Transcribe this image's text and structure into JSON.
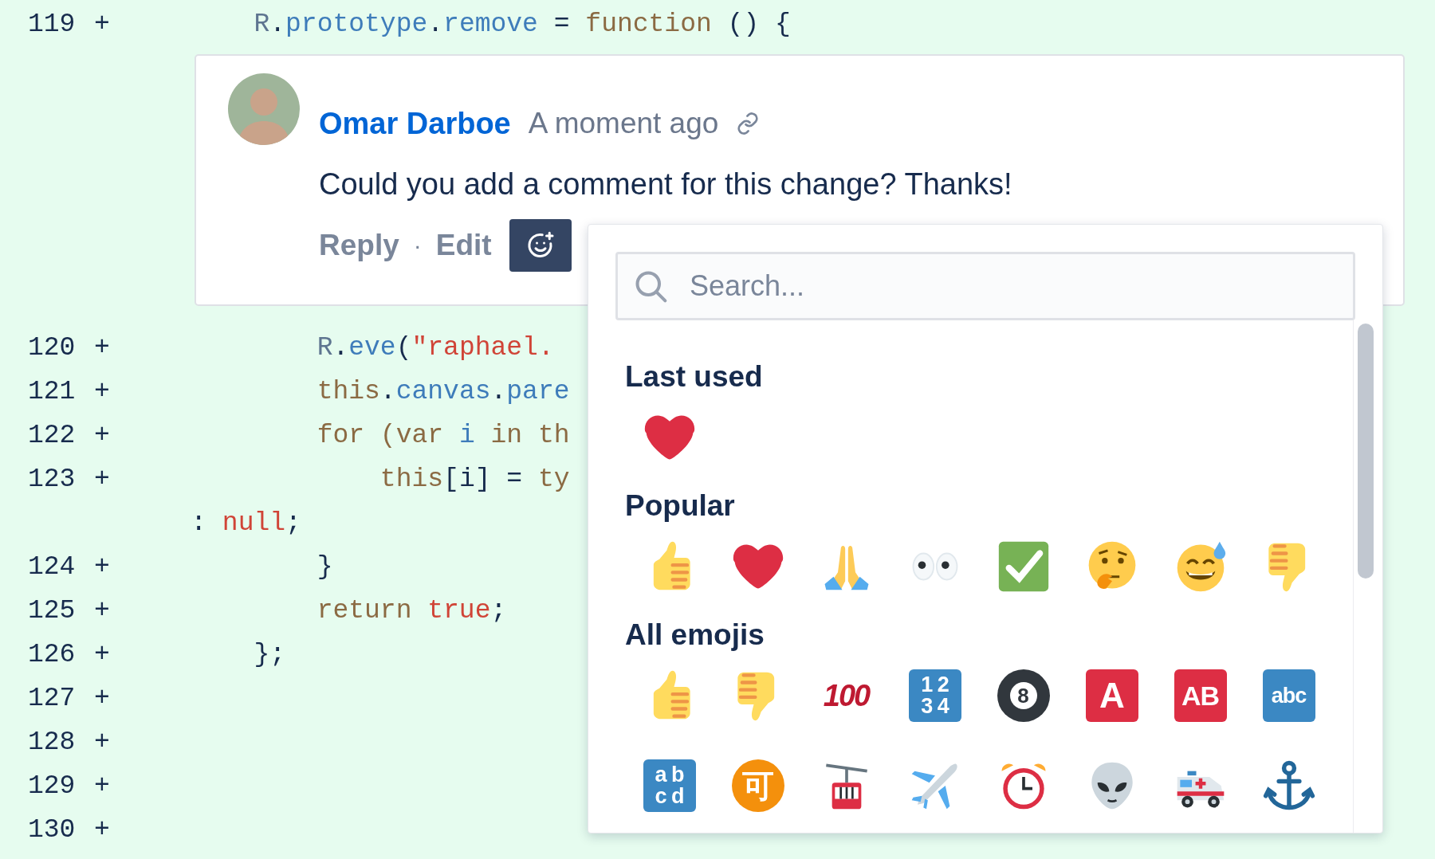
{
  "diff_lines": [
    {
      "kind": "code",
      "number": "119",
      "marker": "+",
      "tokens": [
        {
          "kind": "object",
          "text": "        R"
        },
        {
          "kind": "plain",
          "text": "."
        },
        {
          "kind": "property",
          "text": "prototype"
        },
        {
          "kind": "plain",
          "text": "."
        },
        {
          "kind": "property",
          "text": "remove"
        },
        {
          "kind": "plain",
          "text": " = "
        },
        {
          "kind": "keyword",
          "text": "function"
        },
        {
          "kind": "plain",
          "text": " () {"
        }
      ]
    },
    {
      "kind": "comment",
      "author": "Omar Darboe",
      "time": "A moment ago",
      "body": "Could you add a comment for this change? Thanks!",
      "actions": [
        "Reply",
        "Edit"
      ],
      "separator": "·",
      "reaction_picker_open": true
    },
    {
      "kind": "code",
      "number": "120",
      "marker": "+",
      "tokens": [
        {
          "kind": "object",
          "text": "            R"
        },
        {
          "kind": "plain",
          "text": "."
        },
        {
          "kind": "property",
          "text": "eve"
        },
        {
          "kind": "plain",
          "text": "("
        },
        {
          "kind": "string",
          "text": "\"raphael."
        }
      ]
    },
    {
      "kind": "code",
      "number": "121",
      "marker": "+",
      "tokens": [
        {
          "kind": "keyword",
          "text": "            this"
        },
        {
          "kind": "plain",
          "text": "."
        },
        {
          "kind": "property",
          "text": "canvas"
        },
        {
          "kind": "plain",
          "text": "."
        },
        {
          "kind": "property",
          "text": "pare"
        }
      ]
    },
    {
      "kind": "code",
      "number": "122",
      "marker": "+",
      "tokens": [
        {
          "kind": "keyword",
          "text": "            for"
        },
        {
          "kind": "keyword",
          "text": " (var "
        },
        {
          "kind": "property",
          "text": "i"
        },
        {
          "kind": "keyword",
          "text": " in th"
        }
      ]
    },
    {
      "kind": "code",
      "number": "123",
      "marker": "+",
      "tokens": [
        {
          "kind": "keyword",
          "text": "                this"
        },
        {
          "kind": "plain",
          "text": "[i] = "
        },
        {
          "kind": "keyword",
          "text": "ty"
        }
      ]
    },
    {
      "kind": "code",
      "tokens": [
        {
          "kind": "plain",
          "text": "    : "
        },
        {
          "kind": "string",
          "text": "null"
        },
        {
          "kind": "plain",
          "text": ";"
        }
      ]
    },
    {
      "kind": "code",
      "number": "124",
      "marker": "+",
      "tokens": [
        {
          "kind": "plain",
          "text": "            }"
        }
      ]
    },
    {
      "kind": "code",
      "number": "125",
      "marker": "+",
      "tokens": [
        {
          "kind": "keyword",
          "text": "            return "
        },
        {
          "kind": "string",
          "text": "true"
        },
        {
          "kind": "plain",
          "text": ";"
        }
      ]
    },
    {
      "kind": "code",
      "number": "126",
      "marker": "+",
      "tokens": [
        {
          "kind": "plain",
          "text": "        };"
        }
      ]
    },
    {
      "kind": "code",
      "number": "127",
      "marker": "+"
    },
    {
      "kind": "code",
      "number": "128",
      "marker": "+"
    },
    {
      "kind": "code",
      "number": "129",
      "marker": "+"
    },
    {
      "kind": "code",
      "number": "130",
      "marker": "+"
    }
  ],
  "emoji_picker": {
    "search": {
      "placeholder": "Search..."
    },
    "sections": [
      {
        "heading": "Last used",
        "rows": [
          [
            {
              "kind": "heart"
            }
          ]
        ]
      },
      {
        "heading": "Popular",
        "rows": [
          [
            {
              "kind": "thumbs-up"
            },
            {
              "kind": "heart"
            },
            {
              "kind": "pray"
            },
            {
              "kind": "eyes"
            },
            {
              "kind": "check"
            },
            {
              "kind": "thinking"
            },
            {
              "kind": "sweat-smile"
            },
            {
              "kind": "thumbs-down"
            }
          ]
        ]
      },
      {
        "heading": "All emojis",
        "rows": [
          [
            {
              "kind": "thumbs-up"
            },
            {
              "kind": "thumbs-down"
            },
            {
              "kind": "hundred",
              "lines": [
                "100"
              ]
            },
            {
              "kind": "tile",
              "color": "#3b88c3",
              "lines": [
                "1 2",
                "3 4"
              ]
            },
            {
              "kind": "ball",
              "lines": [
                "8"
              ]
            },
            {
              "kind": "tile",
              "color": "#dd2e44",
              "lines": [
                "A"
              ]
            },
            {
              "kind": "tile",
              "color": "#dd2e44",
              "lines": [
                "AB"
              ]
            },
            {
              "kind": "tile",
              "color": "#3b88c3",
              "lines": [
                "abc"
              ]
            }
          ],
          [
            {
              "kind": "tile",
              "color": "#3b88c3",
              "lines": [
                "a b",
                "c d"
              ]
            },
            {
              "kind": "badge",
              "lines": [
                "可"
              ]
            },
            {
              "kind": "gondola"
            },
            {
              "kind": "airplane"
            },
            {
              "kind": "alarm-clock"
            },
            {
              "kind": "alien"
            },
            {
              "kind": "ambulance"
            },
            {
              "kind": "anchor"
            }
          ]
        ]
      }
    ]
  }
}
